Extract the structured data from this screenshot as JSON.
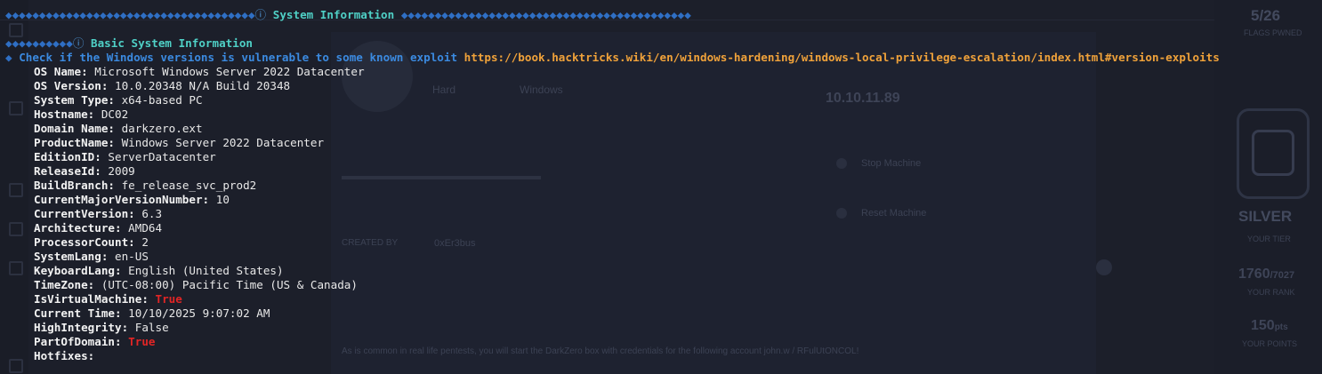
{
  "terminal": {
    "header": {
      "lead": "◆◆◆◆◆◆◆◆◆◆◆◆◆◆◆◆◆◆◆◆◆◆◆◆◆◆◆◆◆◆◆◆◆◆◆◆◆",
      "icon": "ⓘ",
      "title": "System Information",
      "tail": "◆◆◆◆◆◆◆◆◆◆◆◆◆◆◆◆◆◆◆◆◆◆◆◆◆◆◆◆◆◆◆◆◆◆◆◆◆◆◆◆◆◆◆"
    },
    "subsection": {
      "lead": "◆◆◆◆◆◆◆◆◆◆",
      "icon": "ⓘ",
      "title": "Basic System Information"
    },
    "hint": {
      "bullet": "◆",
      "text": "Check if the Windows versions is vulnerable to some known exploit",
      "link": "https://book.hacktricks.wiki/en/windows-hardening/windows-local-privilege-escalation/index.html#version-exploits"
    },
    "fields": [
      {
        "key": "OS Name:",
        "value": "Microsoft Windows Server 2022 Datacenter"
      },
      {
        "key": "OS Version:",
        "value": "10.0.20348 N/A Build 20348"
      },
      {
        "key": "System Type:",
        "value": "x64-based PC"
      },
      {
        "key": "Hostname:",
        "value": "DC02"
      },
      {
        "key": "Domain Name:",
        "value": "darkzero.ext"
      },
      {
        "key": "ProductName:",
        "value": "Windows Server 2022 Datacenter"
      },
      {
        "key": "EditionID:",
        "value": "ServerDatacenter"
      },
      {
        "key": "ReleaseId:",
        "value": "2009"
      },
      {
        "key": "BuildBranch:",
        "value": "fe_release_svc_prod2"
      },
      {
        "key": "CurrentMajorVersionNumber:",
        "value": "10"
      },
      {
        "key": "CurrentVersion:",
        "value": "6.3"
      },
      {
        "key": "Architecture:",
        "value": "AMD64"
      },
      {
        "key": "ProcessorCount:",
        "value": "2"
      },
      {
        "key": "SystemLang:",
        "value": "en-US"
      },
      {
        "key": "KeyboardLang:",
        "value": "English (United States)"
      },
      {
        "key": "TimeZone:",
        "value": "(UTC-08:00) Pacific Time (US & Canada)"
      },
      {
        "key": "IsVirtualMachine:",
        "value": "True",
        "highlight": true
      },
      {
        "key": "Current Time:",
        "value": "10/10/2025 9:07:02 AM"
      },
      {
        "key": "HighIntegrity:",
        "value": "False"
      },
      {
        "key": "PartOfDomain:",
        "value": "True",
        "highlight": true
      },
      {
        "key": "Hotfixes:",
        "value": ""
      }
    ]
  },
  "background_page": {
    "flags_count": "5/26",
    "flags_label": "FLAGS PWNED",
    "ip": "10.10.11.89",
    "tag_hard": "Hard",
    "tag_os": "Windows",
    "stop_machine": "Stop Machine",
    "reset_machine": "Reset Machine",
    "created_by_label": "CREATED BY",
    "creator": "0xEr3bus",
    "tier": "SILVER",
    "tier_label": "YOUR TIER",
    "rank": "1760",
    "rank_total": "/7027",
    "rank_label": "YOUR RANK",
    "points": "150",
    "points_unit": "pts",
    "points_label": "YOUR POINTS",
    "description": "As is common in real life pentests, you will start the DarkZero box with credentials for the following account john.w / RFulUtONCOL!"
  },
  "colors": {
    "background": "#1c1f2a",
    "diamonds": "#2f6fc4",
    "section_title": "#4fd0c6",
    "hint": "#3b8ae0",
    "link": "#f0a23a",
    "true_value": "#e22525"
  }
}
